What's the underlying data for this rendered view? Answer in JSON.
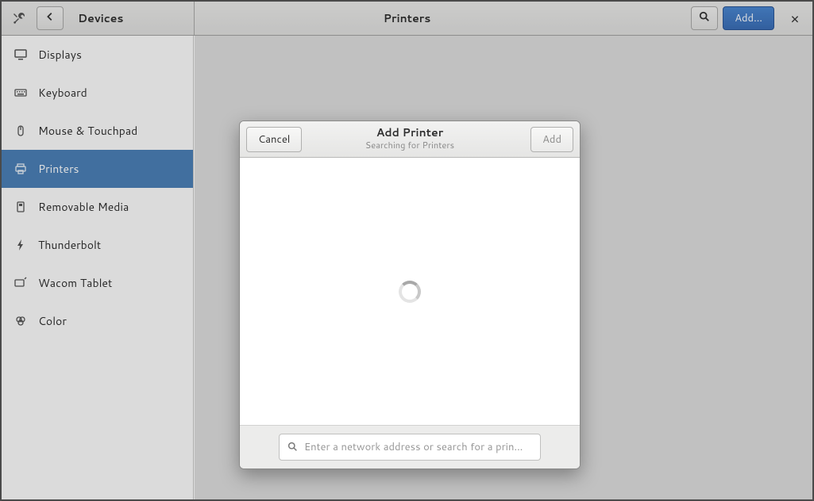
{
  "header": {
    "devices_label": "Devices",
    "page_title": "Printers",
    "add_button": "Add…"
  },
  "sidebar": {
    "items": [
      {
        "label": "Displays"
      },
      {
        "label": "Keyboard"
      },
      {
        "label": "Mouse & Touchpad"
      },
      {
        "label": "Printers"
      },
      {
        "label": "Removable Media"
      },
      {
        "label": "Thunderbolt"
      },
      {
        "label": "Wacom Tablet"
      },
      {
        "label": "Color"
      }
    ],
    "selected_index": 3
  },
  "dialog": {
    "title": "Add Printer",
    "subtitle": "Searching for Printers",
    "cancel_label": "Cancel",
    "add_label": "Add",
    "search_placeholder": "Enter a network address or search for a prin…"
  }
}
